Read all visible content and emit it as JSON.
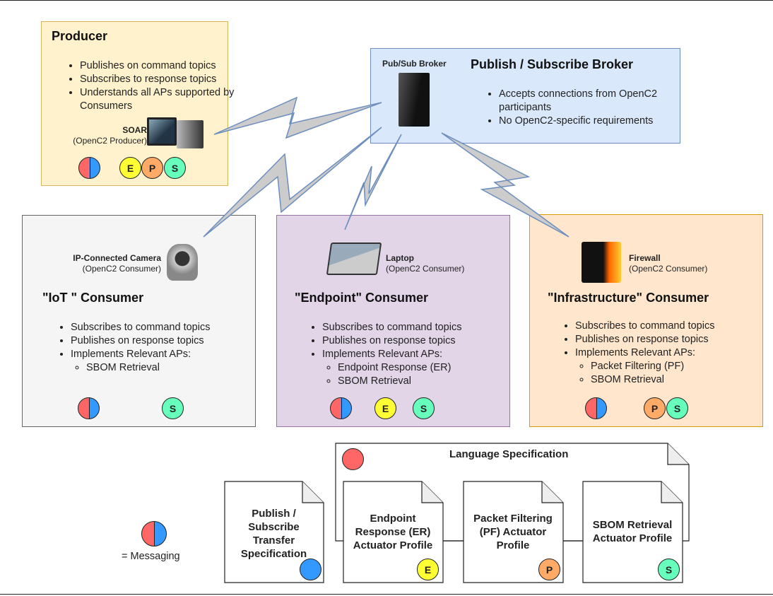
{
  "producer": {
    "title": "Producer",
    "bullets": [
      "Publishes on command topics",
      "Subscribes to response topics",
      "Understands all APs supported by Consumers"
    ],
    "device_name": "SOAR",
    "device_role": "(OpenC2 Producer)",
    "icon": "desktop-computer-icon",
    "badges": [
      "E",
      "P",
      "S"
    ]
  },
  "broker": {
    "title": "Publish / Subscribe Broker",
    "device_name": "Pub/Sub Broker",
    "icon": "server-tower-icon",
    "bullets": [
      "Accepts connections from OpenC2 participants",
      "No OpenC2-specific requirements"
    ]
  },
  "iot": {
    "title": "\"IoT \" Consumer",
    "device_name": "IP-Connected Camera",
    "device_role": "(OpenC2 Consumer)",
    "icon": "ip-camera-icon",
    "bullets": [
      "Subscribes to command topics",
      "Publishes on response topics",
      "Implements Relevant APs:"
    ],
    "aps": [
      "SBOM Retrieval"
    ],
    "badges": [
      "S"
    ]
  },
  "endpoint": {
    "title": "\"Endpoint\" Consumer",
    "device_name": "Laptop",
    "device_role": "(OpenC2 Consumer)",
    "icon": "laptop-icon",
    "bullets": [
      "Subscribes to command topics",
      "Publishes on response topics",
      "Implements Relevant APs:"
    ],
    "aps": [
      "Endpoint Response (ER)",
      "SBOM Retrieval"
    ],
    "badges": [
      "E",
      "S"
    ]
  },
  "infra": {
    "title": "\"Infrastructure\" Consumer",
    "device_name": "Firewall",
    "device_role": "(OpenC2 Consumer)",
    "icon": "firewall-icon",
    "bullets": [
      "Subscribes to command topics",
      "Publishes on response topics",
      "Implements Relevant APs:"
    ],
    "aps": [
      "Packet Filtering (PF)",
      "SBOM Retrieval"
    ],
    "badges": [
      "P",
      "S"
    ]
  },
  "legend": {
    "label": "= Messaging"
  },
  "docs": {
    "language": "Language Specification",
    "transfer": "Publish / Subscribe Transfer Specification",
    "er": "Endpoint Response (ER) Actuator Profile",
    "pf": "Packet Filtering (PF) Actuator Profile",
    "sbom": "SBOM Retrieval Actuator Profile"
  },
  "colors": {
    "language": "#ff6666",
    "transfer": "#3399ff",
    "E": "#ffff33",
    "P": "#ffaa66",
    "S": "#66ffbb",
    "producer_fill": "#fff2cc",
    "broker_fill": "#dae8fc",
    "iot_fill": "#f5f5f5",
    "endpoint_fill": "#e1d5e7",
    "infra_fill": "#ffe6cc",
    "link": "#6c8ebf"
  }
}
